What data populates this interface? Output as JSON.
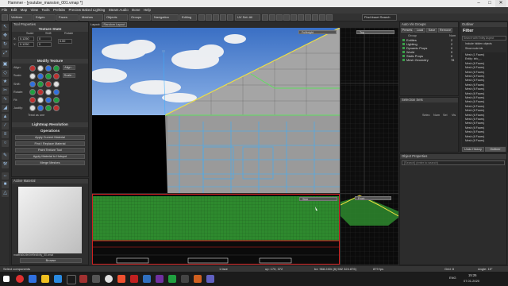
{
  "window": {
    "title": "Hammer - [youtube_mansion_001.vmap *]",
    "minimize": "–",
    "maximize": "□",
    "close": "✕"
  },
  "menu": [
    "File",
    "Edit",
    "Map",
    "View",
    "Tools",
    "Prefabs",
    "Preview Baked Lighting",
    "Steam Audio",
    "Done",
    "Help"
  ],
  "toolbar": {
    "select_label": "Select",
    "buttons": [
      "Vertices",
      "Edges",
      "Faces",
      "Meshes",
      "Objects",
      "Groups",
      "Navigation",
      "Editing"
    ],
    "search_placeholder": "Find Asset Search",
    "grid_value": "UV Set: All"
  },
  "tool_properties": {
    "header": "Tool Properties",
    "texture_state_title": "Texture State",
    "scale_label": "Scale",
    "shift_label": "Shift",
    "rotate_label": "Rotate",
    "x_scale": "0.1250",
    "y_scale": "0.1250",
    "x_shift": "0",
    "y_shift": "0",
    "rotate_value": "0.00",
    "modify_texture_title": "Modify Texture",
    "row_labels": [
      "Align:",
      "Scale:",
      "Shift:",
      "Rotate:",
      "Fit:",
      "Justify:"
    ],
    "treat_as_one": "Treat as one",
    "lightmap_title": "Lightmap Resolution",
    "operations_title": "Operations",
    "operations": [
      "Apply Current Material",
      "Find / Replace Material",
      "Paint Texture Tool",
      "Apply Material to Hotspot",
      "Merge Meshes"
    ],
    "align_button": "Align...",
    "scale_button": "Scale..."
  },
  "active_material": {
    "header": "Active Material",
    "path": "materials/dev/reflectivity_50.vmat",
    "browse_label": "Browse"
  },
  "viewports": {
    "main_label": "Fullbright",
    "top_right_label": "Top",
    "bottom_left_label": "Side",
    "bottom_right_label": "Front",
    "layout_label": "Layout:",
    "layout_value": "Random Layout"
  },
  "auto_vis_groups": {
    "header": "Auto Vis Groups",
    "buttons": [
      "Presets",
      "Load",
      "Save",
      "Remove"
    ],
    "col_group": "Group",
    "col_num": "Num",
    "items": [
      {
        "name": "Entities",
        "num": "2"
      },
      {
        "name": "Lighting",
        "num": "2"
      },
      {
        "name": "Dynamic Props",
        "num": "0"
      },
      {
        "name": "World",
        "num": "0"
      },
      {
        "name": "Static Props",
        "num": "0"
      },
      {
        "name": "Mesh Geometry",
        "num": "78"
      }
    ]
  },
  "selection_sets": {
    "header": "Selection Sets",
    "columns": [
      "Selec",
      "Num",
      "Sel",
      "Vis"
    ]
  },
  "object_properties": {
    "header": "Object Properties",
    "search_placeholder": "[Search] (enter to search)"
  },
  "outliner": {
    "header": "Outliner",
    "filter_title": "Filter",
    "search_placeholder": "Search with Entity Aspect",
    "include_hidden": "Include hidden objects",
    "show_node_ids": "Show node ids",
    "rows": [
      "Mesh (1 Faces)",
      "Entity: info_...",
      "Mesh (6 Faces)",
      "Mesh (6 Faces)",
      "Mesh (6 Faces)",
      "Mesh (6 Faces)",
      "Mesh (6 Faces)",
      "Mesh (6 Faces)",
      "Mesh (6 Faces)",
      "Mesh (6 Faces)",
      "Mesh (6 Faces)",
      "Mesh (6 Faces)",
      "Mesh (6 Faces)",
      "Mesh (6 Faces)",
      "Mesh (6 Faces)",
      "Mesh (6 Faces)",
      "Mesh (6 Faces)",
      "Mesh (6 Faces)",
      "Mesh (6 Faces)",
      "Mesh (6 Faces)",
      "Mesh (6 Faces)"
    ],
    "tabs": [
      "Undo History",
      "Outliner"
    ]
  },
  "status": {
    "left": "Select components",
    "faces": "1 face",
    "coords": "up: 170, 372",
    "dims": "bx: 968.240r (8) 552 324.876)",
    "fps": "879 fps",
    "grid": "Grid: 8",
    "snap": "Angle: 15°"
  },
  "taskbar": {
    "time": "15:25",
    "date": "07.01.2020",
    "lang": "ENG"
  },
  "colors": {
    "accent_green": "#3aa04a",
    "selection_yellow": "#f0e040",
    "wire_blue": "#3ab0ff",
    "viewport_red": "#d02020"
  }
}
